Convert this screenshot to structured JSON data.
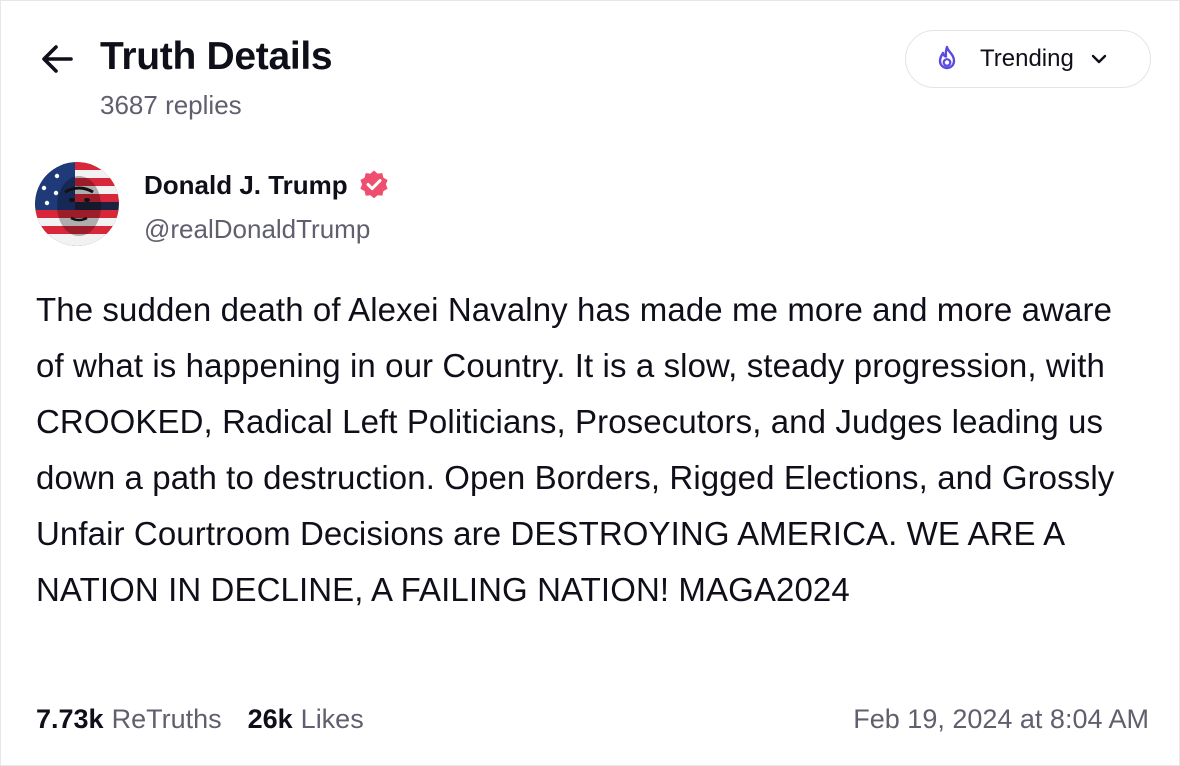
{
  "header": {
    "title": "Truth Details",
    "reply_count": "3687 replies",
    "sort": {
      "selected": "Trending",
      "icon": "flame-icon"
    },
    "back_icon": "arrow-left-icon"
  },
  "author": {
    "display_name": "Donald J. Trump",
    "handle": "@realDonaldTrump",
    "verified": true,
    "verified_color": "#f04e6e"
  },
  "post": {
    "text": "The sudden death of Alexei Navalny has made me more and more aware of what is happening in our Country. It is a slow, steady progression, with CROOKED, Radical Left Politicians, Prosecutors, and Judges leading us down a path to destruction. Open Borders, Rigged Elections, and Grossly Unfair Courtroom Decisions are DESTROYING AMERICA. WE ARE A NATION IN DECLINE, A FAILING NATION! MAGA2024"
  },
  "stats": {
    "retruths_count": "7.73k",
    "retruths_label": "ReTruths",
    "likes_count": "26k",
    "likes_label": "Likes"
  },
  "timestamp": "Feb 19, 2024 at 8:04 AM",
  "colors": {
    "accent": "#5b4ae0",
    "text_primary": "#0f0f1a",
    "text_secondary": "#5f5f6e",
    "border": "#e3e3ea"
  }
}
